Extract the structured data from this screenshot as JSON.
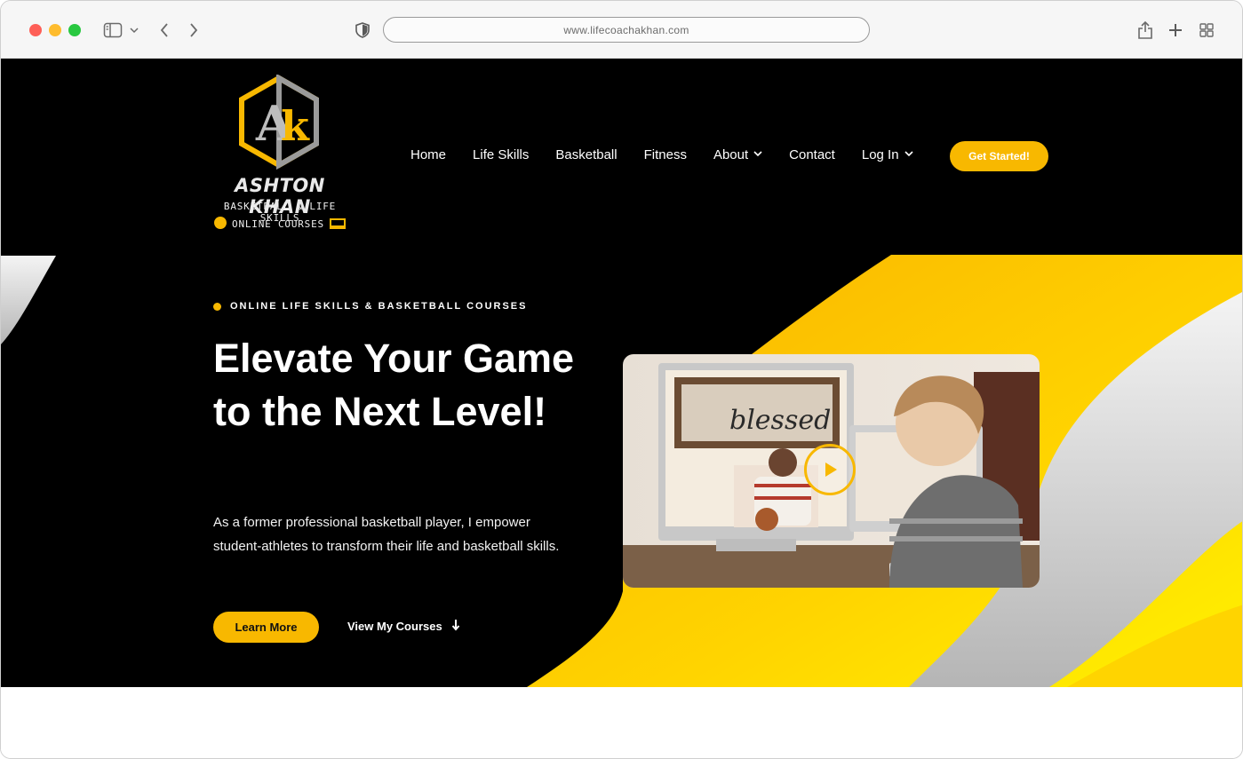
{
  "browser": {
    "url": "www.lifecoachakhan.com"
  },
  "logo": {
    "monogram": "AK",
    "name": "ASHTON KHAN",
    "line1": "BASKETBALL & LIFE SKILLS",
    "line2": "ONLINE COURSES"
  },
  "nav": {
    "items": [
      {
        "label": "Home"
      },
      {
        "label": "Life Skills"
      },
      {
        "label": "Basketball"
      },
      {
        "label": "Fitness"
      },
      {
        "label": "About"
      },
      {
        "label": "Contact"
      },
      {
        "label": "Log In"
      }
    ],
    "cta": "Get Started!"
  },
  "hero": {
    "kicker": "ONLINE LIFE SKILLS & BASKETBALL COURSES",
    "headline": "Elevate Your Game to the Next Level!",
    "body": "As a former professional basketball player, I empower student-athletes to transform their life and basketball skills.",
    "primary_button": "Learn More",
    "secondary_button": "View My Courses",
    "video_sign_text": "blessed"
  },
  "colors": {
    "accent": "#f8b800",
    "background": "#000000",
    "text": "#ffffff"
  },
  "icons": {
    "sidebar": "sidebar-icon",
    "shield": "shield-icon",
    "share": "share-icon",
    "new_tab": "plus-icon",
    "tabs": "grid-icon",
    "play": "play-icon"
  }
}
